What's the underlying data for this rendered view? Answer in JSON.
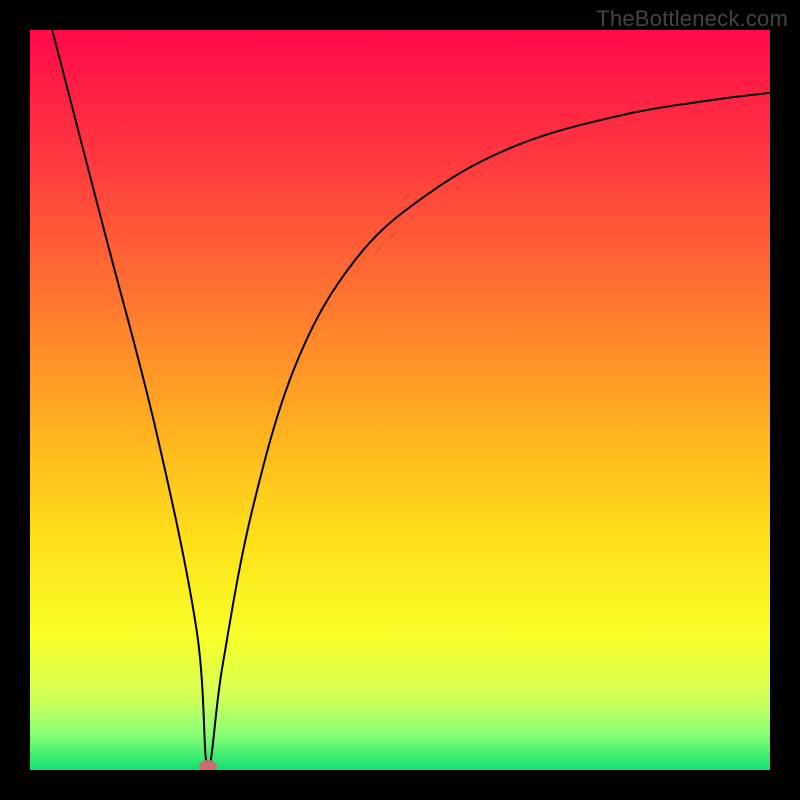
{
  "watermark": "TheBottleneck.com",
  "colors": {
    "frame": "#000000",
    "marker": "#cc6d6d",
    "curve": "#000000",
    "gradient_stops": [
      {
        "pct": 0,
        "color": "#ff0a4a"
      },
      {
        "pct": 18,
        "color": "#ff3a3f"
      },
      {
        "pct": 38,
        "color": "#ff7b2e"
      },
      {
        "pct": 55,
        "color": "#ffb51f"
      },
      {
        "pct": 70,
        "color": "#ffe31a"
      },
      {
        "pct": 82,
        "color": "#f7ff29"
      },
      {
        "pct": 90,
        "color": "#d4ff55"
      },
      {
        "pct": 95,
        "color": "#8dff74"
      },
      {
        "pct": 100,
        "color": "#10e070"
      }
    ]
  },
  "chart_data": {
    "type": "line",
    "title": "",
    "xlabel": "",
    "ylabel": "",
    "xlim": [
      0,
      100
    ],
    "ylim": [
      0,
      100
    ],
    "series": [
      {
        "name": "bottleneck-curve",
        "x": [
          3,
          10,
          17,
          22.5,
          24,
          26,
          30,
          36,
          44,
          54,
          66,
          80,
          92,
          100
        ],
        "values": [
          100,
          73,
          46,
          19,
          0.5,
          14,
          35,
          55,
          69,
          78,
          84.5,
          88.5,
          90.5,
          91.5
        ]
      }
    ],
    "annotations": [
      {
        "name": "min-marker",
        "x": 24,
        "y": 0.5
      }
    ]
  }
}
